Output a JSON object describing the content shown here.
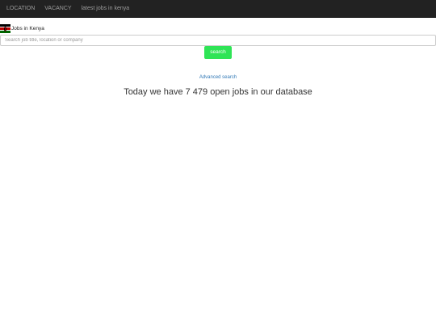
{
  "navbar": {
    "items": [
      {
        "label": "LOCATION"
      },
      {
        "label": "VACANCY"
      },
      {
        "label": "latest jobs in kenya"
      }
    ]
  },
  "brand": {
    "flag_icon": "kenya-flag-icon",
    "label": "Jobs in Kenya"
  },
  "search": {
    "placeholder": "Search job title, location or company",
    "value": "",
    "button_label": "search",
    "button_color": "#2fe456"
  },
  "advanced_search": {
    "label": "Advanced search"
  },
  "headline": {
    "text": "Today we have 7 479 open jobs in our database"
  }
}
